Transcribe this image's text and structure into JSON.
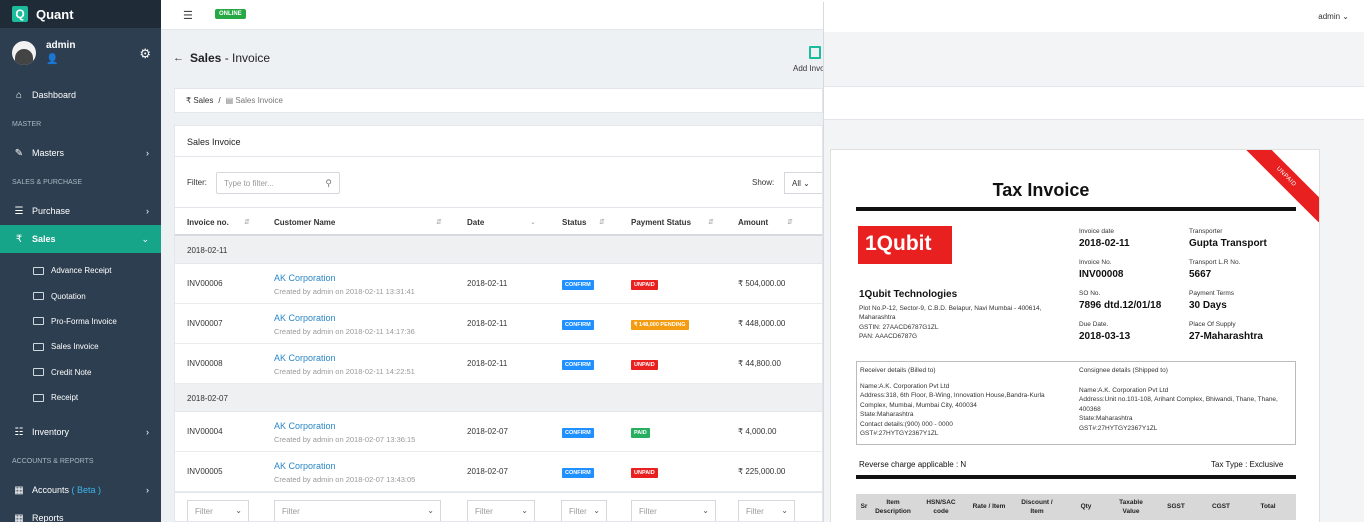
{
  "app": {
    "name": "Quant",
    "logo_letter": "Q"
  },
  "user": {
    "name": "admin"
  },
  "topbar": {
    "status": "ONLINE"
  },
  "sidebar": {
    "dashboard": "Dashboard",
    "section_master": "MASTER",
    "masters": "Masters",
    "section_sales": "SALES & PURCHASE",
    "purchase": "Purchase",
    "sales": "Sales",
    "sales_items": [
      "Advance Receipt",
      "Quotation",
      "Pro-Forma Invoice",
      "Sales Invoice",
      "Credit Note",
      "Receipt"
    ],
    "inventory": "Inventory",
    "section_accounts": "ACCOUNTS & REPORTS",
    "accounts": "Accounts",
    "accounts_beta": "( Beta )",
    "reports": "Reports"
  },
  "page": {
    "title_bold": "Sales",
    "title_rest": " - Invoice",
    "add_label": "Add Invo"
  },
  "breadcrumb": {
    "root": "₹ Sales",
    "sep": "/",
    "current": "Sales Invoice"
  },
  "list": {
    "card_title": "Sales Invoice",
    "filter_label": "Filter:",
    "filter_placeholder": "Type to filter...",
    "show_label": "Show:",
    "show_value": "All",
    "columns": [
      "Invoice no.",
      "Customer Name",
      "Date",
      "Status",
      "Payment Status",
      "Amount"
    ],
    "groups": [
      {
        "date": "2018-02-11",
        "rows": [
          {
            "invoice": "INV00006",
            "customer": "AK Corporation",
            "created": "Created by admin on 2018-02-11 13:31:41",
            "date": "2018-02-11",
            "status": "CONFIRM",
            "payment": "UNPAID",
            "pay_color": "#e82020",
            "amount": "₹ 504,000.00"
          },
          {
            "invoice": "INV00007",
            "customer": "AK Corporation",
            "created": "Created by admin on 2018-02-11 14:17:36",
            "date": "2018-02-11",
            "status": "CONFIRM",
            "payment": "₹ 148,000 PENDING",
            "pay_color": "#f39c12",
            "amount": "₹ 448,000.00"
          },
          {
            "invoice": "INV00008",
            "customer": "AK Corporation",
            "created": "Created by admin on 2018-02-11 14:22:51",
            "date": "2018-02-11",
            "status": "CONFIRM",
            "payment": "UNPAID",
            "pay_color": "#e82020",
            "amount": "₹ 44,800.00"
          }
        ]
      },
      {
        "date": "2018-02-07",
        "rows": [
          {
            "invoice": "INV00004",
            "customer": "AK Corporation",
            "created": "Created by admin on 2018-02-07 13:36:15",
            "date": "2018-02-07",
            "status": "CONFIRM",
            "payment": "PAID",
            "pay_color": "#27ae60",
            "amount": "₹ 4,000.00"
          },
          {
            "invoice": "INV00005",
            "customer": "AK Corporation",
            "created": "Created by admin on 2018-02-07 13:43:05",
            "date": "2018-02-07",
            "status": "CONFIRM",
            "payment": "UNPAID",
            "pay_color": "#e82020",
            "amount": "₹ 225,000.00"
          }
        ]
      }
    ],
    "footer_filter": "Filter",
    "status_color": "#1e90ff"
  },
  "panel": {
    "user": "admin",
    "ribbon": "UNPAID",
    "title": "Tax Invoice",
    "logo_text": "1Qubit",
    "company": {
      "name": "1Qubit Technologies",
      "address": "Plot No.P-12, Sector-9, C.B.D. Belapur, Navi Mumbai - 400614, Maharashtra",
      "gstin": "GSTIN: 27AACD6787G1ZL",
      "pan": "PAN: AAACD6787G"
    },
    "fields": [
      {
        "label": "Invoice date",
        "value": "2018-02-11"
      },
      {
        "label": "Transporter",
        "value": "Gupta Transport"
      },
      {
        "label": "Invoice No.",
        "value": "INV00008"
      },
      {
        "label": "Transport L.R No.",
        "value": "5667"
      },
      {
        "label": "SO No.",
        "value": "7896 dtd.12/01/18"
      },
      {
        "label": "Payment Terms",
        "value": "30 Days"
      },
      {
        "label": "Due Date.",
        "value": "2018-03-13"
      },
      {
        "label": "Place Of Supply",
        "value": "27-Maharashtra"
      }
    ],
    "receiver": {
      "title": "Receiver details (Billed to)",
      "lines": [
        "Name:A.K. Corporation Pvt Ltd",
        "Address:318, 6th Floor, B-Wing, Innovation House,Bandra-Kurla Complex, Mumbai, Mumbai City, 400034",
        "State:Maharashtra",
        "Contact details:(900) 000 - 0000",
        "GST#:27HYTGY2367Y1ZL"
      ]
    },
    "consignee": {
      "title": "Consignee details (Shipped to)",
      "lines": [
        "Name:A.K. Corporation Pvt Ltd",
        "Address:Unit no.101-108, Arihant Complex, Bhiwandi, Thane, Thane, 400368",
        "State:Maharashtra",
        "GST#:27HYTGY2367Y1ZL"
      ]
    },
    "reverse": "Reverse charge applicable : N",
    "taxtype": "Tax Type : Exclusive",
    "table_headers": [
      "Sr",
      "Item Description",
      "HSN/SAC code",
      "Rate / Item",
      "Discount / Item",
      "Qty",
      "Taxable Value",
      "SGST",
      "CGST",
      "Total"
    ]
  }
}
